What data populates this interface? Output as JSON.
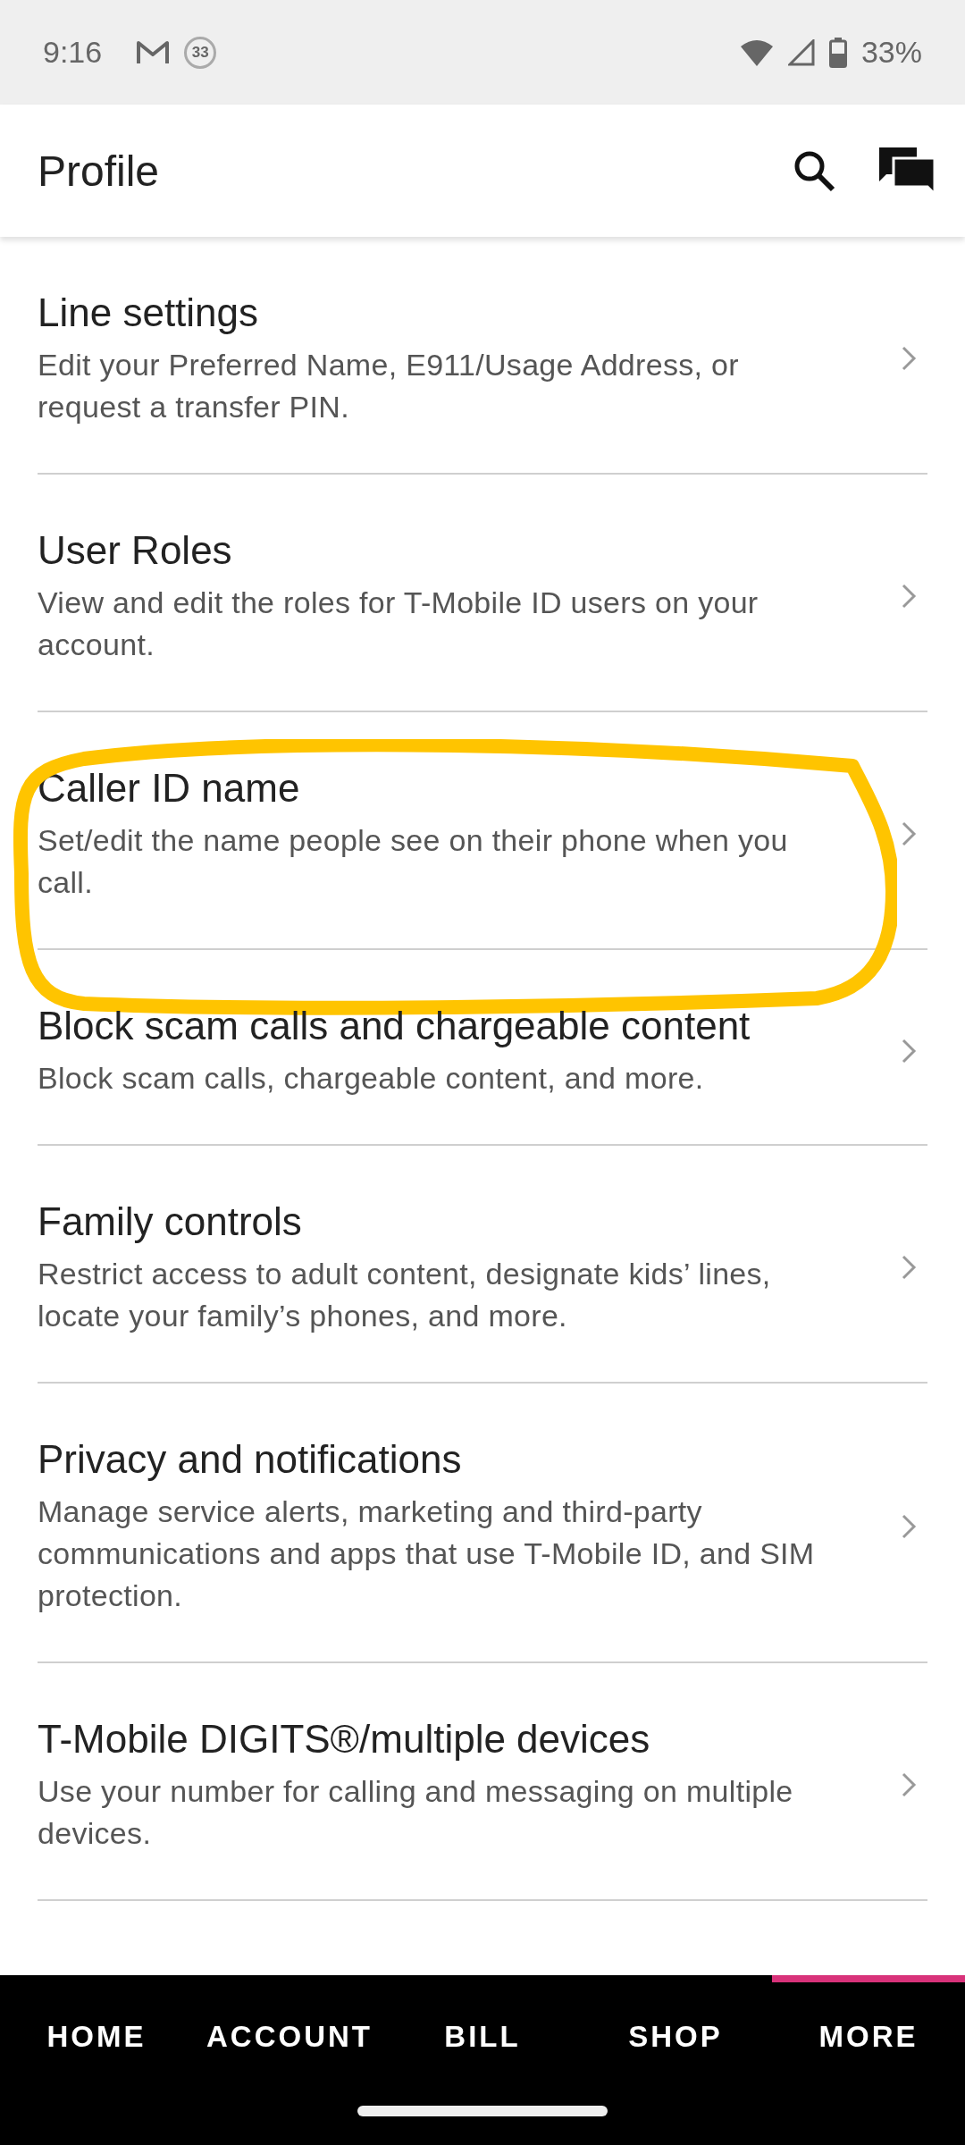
{
  "status_bar": {
    "time": "9:16",
    "notification_count": "33",
    "battery": "33%"
  },
  "app_bar": {
    "title": "Profile"
  },
  "items": [
    {
      "title": "Line settings",
      "description": "Edit your Preferred Name, E911/Usage Address, or request a transfer PIN.",
      "circled": false
    },
    {
      "title": "User Roles",
      "description": "View and edit the roles for T-Mobile ID users on your account.",
      "circled": false
    },
    {
      "title": "Caller ID name",
      "description": "Set/edit the name people see on their phone when you call.",
      "circled": true
    },
    {
      "title": "Block scam calls and chargeable content",
      "description": "Block scam calls, chargeable content, and more.",
      "circled": false
    },
    {
      "title": "Family controls",
      "description": "Restrict access to adult content, designate kids’ lines, locate your family’s phones, and more.",
      "circled": false
    },
    {
      "title": "Privacy and notifications",
      "description": "Manage service alerts, marketing and third-party communications and apps that use T-Mobile ID, and SIM protection.",
      "circled": false
    },
    {
      "title": "T-Mobile DIGITS®/multiple devices",
      "description": "Use your number for calling and messaging on multiple devices.",
      "circled": false
    }
  ],
  "nav": [
    {
      "label": "HOME",
      "selected": false
    },
    {
      "label": "ACCOUNT",
      "selected": false
    },
    {
      "label": "BILL",
      "selected": false
    },
    {
      "label": "SHOP",
      "selected": false
    },
    {
      "label": "MORE",
      "selected": true
    }
  ]
}
